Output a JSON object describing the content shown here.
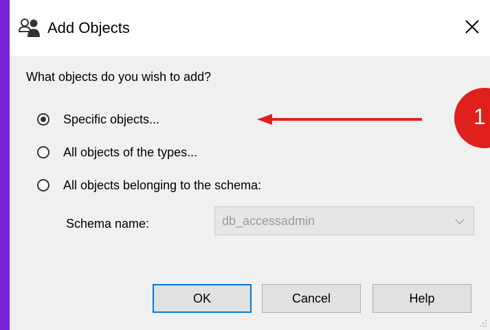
{
  "window": {
    "title": "Add Objects",
    "title_icon": "users-icon",
    "close_icon": "close-icon"
  },
  "question": "What objects do you wish to add?",
  "options": [
    {
      "label": "Specific objects...",
      "checked": true
    },
    {
      "label": "All objects of the types...",
      "checked": false
    },
    {
      "label": "All objects belonging to the schema:",
      "checked": false
    }
  ],
  "schema": {
    "label": "Schema name:",
    "value": "db_accessadmin",
    "disabled": true
  },
  "buttons": {
    "ok": "OK",
    "cancel": "Cancel",
    "help": "Help"
  },
  "annotation": {
    "badge_text": "1",
    "color": "#e0201c"
  },
  "colors": {
    "background": "#7a22d6",
    "dialog": "#f0f0f0",
    "default_button_border": "#0078d7"
  }
}
